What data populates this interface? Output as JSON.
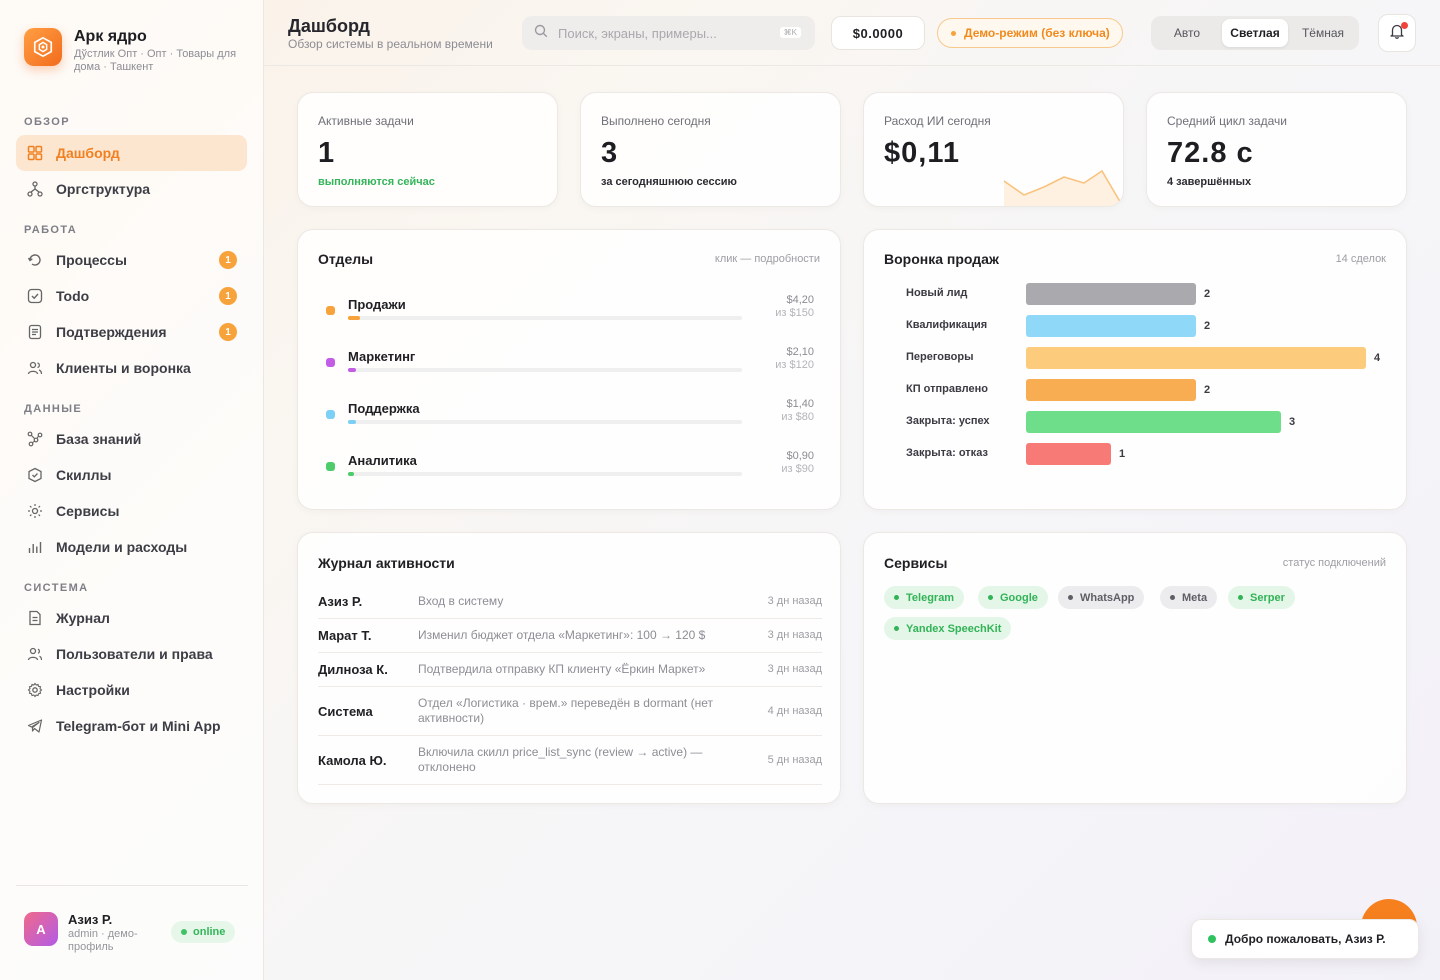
{
  "brand": {
    "title": "Арк ядро",
    "subtitle": "Дўстлик Опт · Опт · Товары для дома · Ташкент"
  },
  "sidebar": {
    "sections": [
      "ОБЗОР",
      "РАБОТА",
      "ДАННЫЕ",
      "СИСТЕМА"
    ],
    "items": [
      {
        "label": "Дашборд",
        "icon": "dashboard-icon",
        "active": true
      },
      {
        "label": "Оргструктура",
        "icon": "org-icon"
      },
      {
        "label": "Процессы",
        "icon": "process-icon",
        "badge": "1"
      },
      {
        "label": "Todo",
        "icon": "todo-icon",
        "badge": "1"
      },
      {
        "label": "Подтверждения",
        "icon": "approval-icon",
        "badge": "1"
      },
      {
        "label": "Клиенты и воронка",
        "icon": "clients-icon"
      },
      {
        "label": "База знаний",
        "icon": "knowledge-icon"
      },
      {
        "label": "Скиллы",
        "icon": "skills-icon"
      },
      {
        "label": "Сервисы",
        "icon": "services-icon"
      },
      {
        "label": "Модели и расходы",
        "icon": "models-icon"
      },
      {
        "label": "Журнал",
        "icon": "log-icon"
      },
      {
        "label": "Пользователи и права",
        "icon": "users-icon"
      },
      {
        "label": "Настройки",
        "icon": "settings-icon"
      },
      {
        "label": "Telegram-бот и Mini App",
        "icon": "telegram-icon"
      }
    ],
    "user": {
      "initial": "A",
      "name": "Азиз Р.",
      "role": "admin · демо-профиль",
      "status": "online"
    }
  },
  "header": {
    "title": "Дашборд",
    "subtitle": "Обзор системы в реальном времени",
    "search_placeholder": "Поиск, экраны, примеры...",
    "search_shortcut": "⌘K",
    "balance": "$0.0000",
    "demo": "Демо-режим (без ключа)",
    "theme_options": [
      "Авто",
      "Светлая",
      "Тёмная"
    ],
    "theme_selected": "Светлая"
  },
  "kpis": [
    {
      "label": "Активные задачи",
      "value": "1",
      "note": "выполняются сейчас"
    },
    {
      "label": "Выполнено сегодня",
      "value": "3",
      "note": "за сегодняшнюю сессию"
    },
    {
      "label": "Расход ИИ сегодня",
      "value": "$0,11",
      "note": ""
    },
    {
      "label": "Средний цикл задачи",
      "value": "72.8 с",
      "note": "4 завершённых"
    }
  ],
  "departments": {
    "title": "Отделы",
    "hint": "клик — подробности",
    "items": [
      {
        "name": "Продажи",
        "spent": "$4,20",
        "of": "из $150",
        "ratio": 0.028,
        "color": "#f7a23a"
      },
      {
        "name": "Маркетинг",
        "spent": "$2,10",
        "of": "из $120",
        "ratio": 0.0175,
        "color": "#c45de6"
      },
      {
        "name": "Поддержка",
        "spent": "$1,40",
        "of": "из $80",
        "ratio": 0.0175,
        "color": "#7dd0f5"
      },
      {
        "name": "Аналитика",
        "spent": "$0,90",
        "of": "из $90",
        "ratio": 0.01,
        "color": "#4ecb6b"
      }
    ]
  },
  "funnel": {
    "title": "Воронка продаж",
    "hint": "14 сделок",
    "stages": [
      {
        "label": "Новый лид",
        "count": 2,
        "color": "#a9a9ae"
      },
      {
        "label": "Квалификация",
        "count": 2,
        "color": "#8fd8f8"
      },
      {
        "label": "Переговоры",
        "count": 4,
        "color": "#fccb7c"
      },
      {
        "label": "КП отправлено",
        "count": 2,
        "color": "#f8ad52"
      },
      {
        "label": "Закрыта: успех",
        "count": 3,
        "color": "#6ede8a"
      },
      {
        "label": "Закрыта: отказ",
        "count": 1,
        "color": "#f87a76"
      }
    ]
  },
  "activity": {
    "title": "Журнал активности",
    "rows": [
      {
        "user": "Азиз Р.",
        "text": "Вход в систему",
        "time": "3 дн назад"
      },
      {
        "user": "Марат Т.",
        "text": "Изменил бюджет отдела «Маркетинг»: 100 → 120 $",
        "time": "3 дн назад"
      },
      {
        "user": "Дилноза К.",
        "text": "Подтвердила отправку КП клиенту «Ёркин Маркет»",
        "time": "3 дн назад"
      },
      {
        "user": "Система",
        "text": "Отдел «Логистика · врем.» переведён в dormant (нет активности)",
        "time": "4 дн назад"
      },
      {
        "user": "Камола Ю.",
        "text": "Включила скилл price_list_sync (review → active) — отклонено",
        "time": "5 дн назад"
      }
    ]
  },
  "services": {
    "title": "Сервисы",
    "hint": "статус подключений",
    "items": [
      {
        "name": "Telegram",
        "on": true
      },
      {
        "name": "Google",
        "on": true
      },
      {
        "name": "WhatsApp",
        "on": false
      },
      {
        "name": "Meta",
        "on": false
      },
      {
        "name": "Serper",
        "on": true
      },
      {
        "name": "Yandex SpeechKit",
        "on": true
      }
    ]
  },
  "toast": "Добро пожаловать, Азиз Р."
}
